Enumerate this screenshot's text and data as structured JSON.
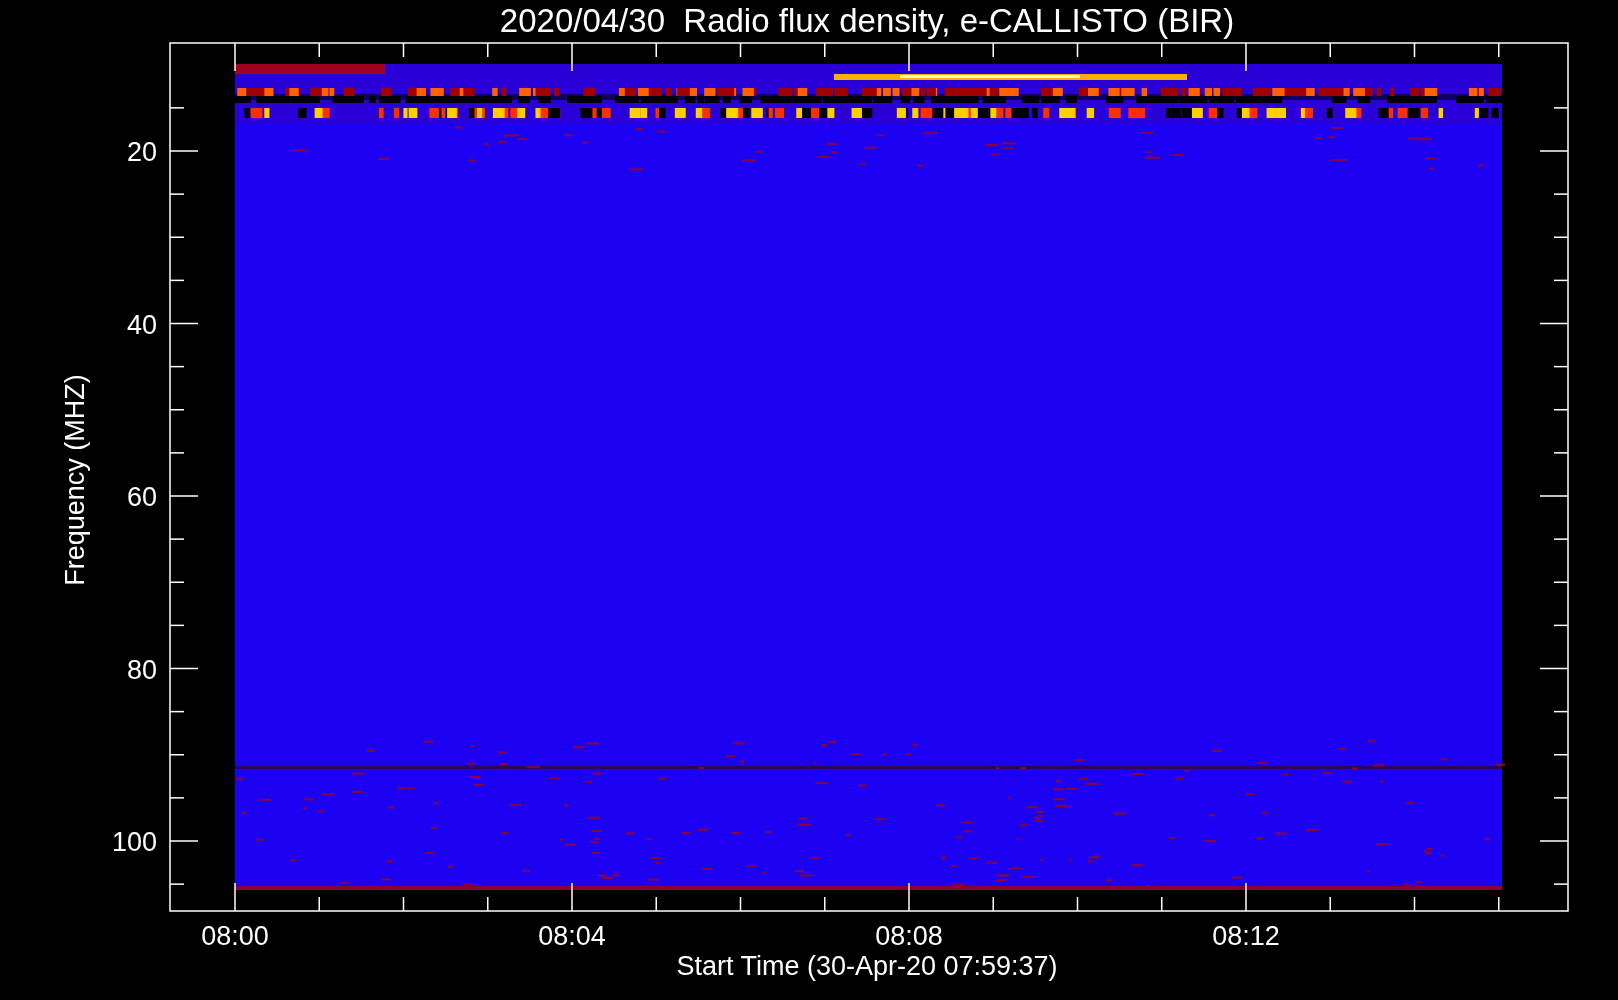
{
  "title": "2020/04/30  Radio flux density, e-CALLISTO (BIR)",
  "y_axis": {
    "label": "Frequency (MHZ)",
    "tick_labels": [
      "20",
      "40",
      "60",
      "80",
      "100"
    ]
  },
  "x_axis": {
    "label": "Start Time (30-Apr-20 07:59:37)",
    "tick_labels": [
      "08:00",
      "08:04",
      "08:08",
      "08:12"
    ]
  }
}
